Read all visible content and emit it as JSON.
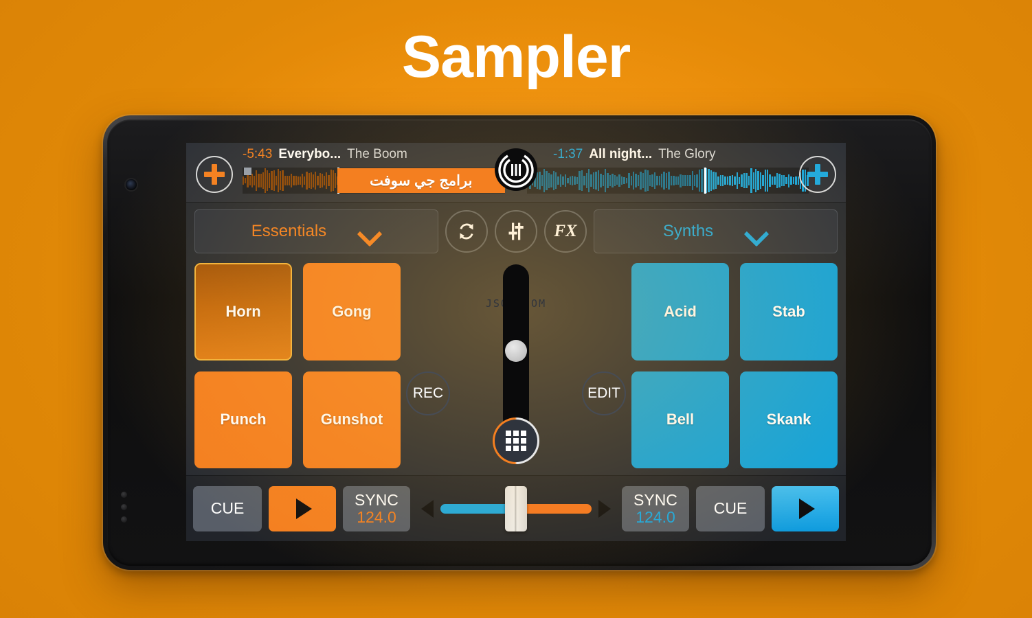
{
  "promo": {
    "title": "Sampler",
    "background_color": "#ED8E0A"
  },
  "colors": {
    "deck_a_accent": "#F47F20",
    "deck_b_accent": "#19A9E2",
    "pad_orange": "#F47F20",
    "pad_blue": "#11A3DC",
    "screen_bg": "#262a31"
  },
  "deck_a": {
    "load_icon": "plus-icon",
    "time_remaining": "-5:43",
    "track_title": "Everybo...",
    "track_artist": "The Boom",
    "waveform_watermark": "برامج جي سوفت"
  },
  "deck_b": {
    "load_icon": "plus-icon",
    "time_remaining": "-1:37",
    "track_title": "All night...",
    "track_artist": "The Glory"
  },
  "center_logo": "crossdj-logo-icon",
  "toolbar": {
    "left_category": "Essentials",
    "left_chevron": "chevron-down-icon",
    "right_category": "Synths",
    "right_chevron": "chevron-down-icon",
    "loop_button": "loop-icon",
    "mixer_button": "mixer-sliders-icon",
    "fx_button": "FX"
  },
  "pads_left": [
    {
      "label": "Horn",
      "active": true
    },
    {
      "label": "Gong",
      "active": false
    },
    {
      "label": "Punch",
      "active": false
    },
    {
      "label": "Gunshot",
      "active": false
    }
  ],
  "pads_right": [
    {
      "label": "Acid",
      "active": false
    },
    {
      "label": "Stab",
      "active": false
    },
    {
      "label": "Bell",
      "active": false
    },
    {
      "label": "Skank",
      "active": false
    }
  ],
  "center": {
    "watermark": "JSOF     COM",
    "volume_slider": "volume-slider",
    "rec_label": "REC",
    "edit_label": "EDIT",
    "grid_button": "pad-grid-icon"
  },
  "transport": {
    "left_cue": "CUE",
    "left_play": "play-icon",
    "left_sync_label": "SYNC",
    "left_bpm": "124.0",
    "right_sync_label": "SYNC",
    "right_bpm": "124.0",
    "right_cue": "CUE",
    "right_play": "play-icon",
    "crossfader_position": "center"
  }
}
